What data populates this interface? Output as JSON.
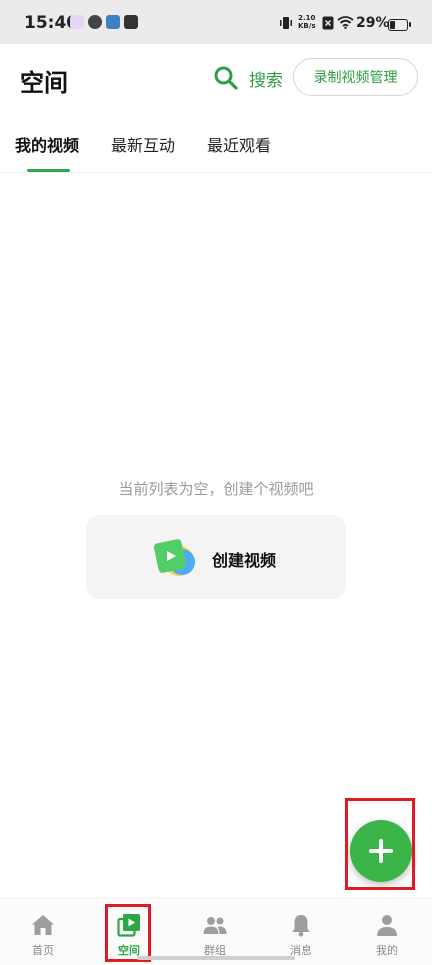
{
  "status_bar": {
    "time": "15:40",
    "net_speed_value": "2.10",
    "net_speed_unit": "KB/s",
    "battery": "29%"
  },
  "header": {
    "title": "空间",
    "search_icon": "search-icon",
    "search_label": "搜索",
    "manage_button": "录制视频管理"
  },
  "tabs": [
    {
      "label": "我的视频",
      "active": true
    },
    {
      "label": "最新互动",
      "active": false
    },
    {
      "label": "最近观看",
      "active": false
    }
  ],
  "empty_state": {
    "message": "当前列表为空，创建个视频吧",
    "create_label": "创建视频",
    "create_icon": "video-create-icon"
  },
  "fab": {
    "icon": "plus-icon"
  },
  "bottom_nav": [
    {
      "label": "首页",
      "icon": "home-icon",
      "active": false
    },
    {
      "label": "空间",
      "icon": "video-space-icon",
      "active": true
    },
    {
      "label": "群组",
      "icon": "group-icon",
      "active": false
    },
    {
      "label": "消息",
      "icon": "bell-icon",
      "active": false
    },
    {
      "label": "我的",
      "icon": "person-icon",
      "active": false
    }
  ],
  "colors": {
    "accent": "#2fa749",
    "fab": "#3bb54a",
    "highlight": "#e01b24",
    "inactive": "#9e9e9e"
  }
}
